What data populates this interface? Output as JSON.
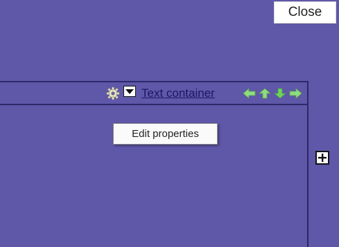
{
  "close_button": {
    "label": "Close"
  },
  "container": {
    "title_link": "Text container",
    "icons": {
      "settings": "gear-icon",
      "menu": "chevron-down-icon",
      "move": [
        "arrow-left-icon",
        "arrow-up-icon",
        "arrow-down-icon",
        "arrow-right-icon"
      ],
      "add": "plus-icon"
    }
  },
  "tooltip": {
    "text": "Edit properties"
  },
  "colors": {
    "background": "#5f57a8",
    "border": "#2e2868",
    "arrow_green": "#8fdc7f",
    "arrow_bright": "#6fd25f"
  }
}
